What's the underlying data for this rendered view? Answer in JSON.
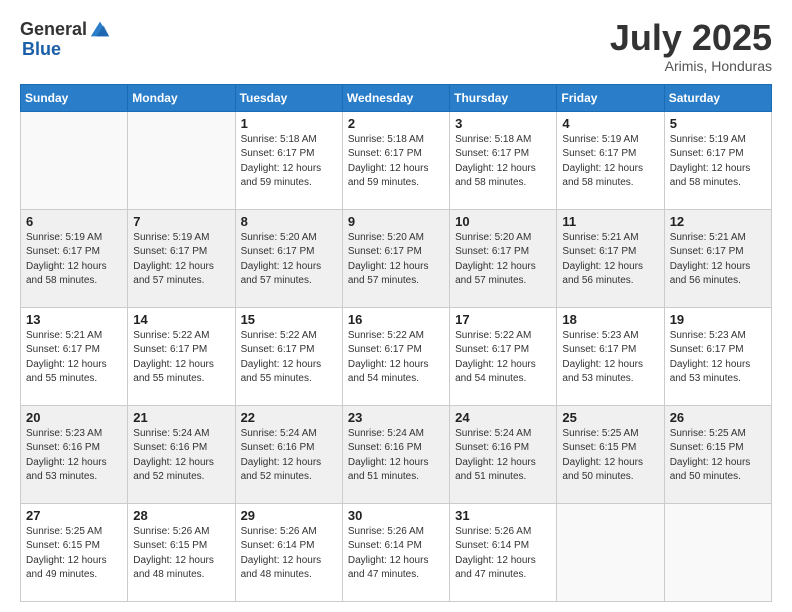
{
  "logo": {
    "text_general": "General",
    "text_blue": "Blue"
  },
  "header": {
    "month": "July 2025",
    "location": "Arimis, Honduras"
  },
  "days_of_week": [
    "Sunday",
    "Monday",
    "Tuesday",
    "Wednesday",
    "Thursday",
    "Friday",
    "Saturday"
  ],
  "weeks": [
    [
      {
        "day": null
      },
      {
        "day": null
      },
      {
        "day": "1",
        "sunrise": "Sunrise: 5:18 AM",
        "sunset": "Sunset: 6:17 PM",
        "daylight": "Daylight: 12 hours and 59 minutes."
      },
      {
        "day": "2",
        "sunrise": "Sunrise: 5:18 AM",
        "sunset": "Sunset: 6:17 PM",
        "daylight": "Daylight: 12 hours and 59 minutes."
      },
      {
        "day": "3",
        "sunrise": "Sunrise: 5:18 AM",
        "sunset": "Sunset: 6:17 PM",
        "daylight": "Daylight: 12 hours and 58 minutes."
      },
      {
        "day": "4",
        "sunrise": "Sunrise: 5:19 AM",
        "sunset": "Sunset: 6:17 PM",
        "daylight": "Daylight: 12 hours and 58 minutes."
      },
      {
        "day": "5",
        "sunrise": "Sunrise: 5:19 AM",
        "sunset": "Sunset: 6:17 PM",
        "daylight": "Daylight: 12 hours and 58 minutes."
      }
    ],
    [
      {
        "day": "6",
        "sunrise": "Sunrise: 5:19 AM",
        "sunset": "Sunset: 6:17 PM",
        "daylight": "Daylight: 12 hours and 58 minutes."
      },
      {
        "day": "7",
        "sunrise": "Sunrise: 5:19 AM",
        "sunset": "Sunset: 6:17 PM",
        "daylight": "Daylight: 12 hours and 57 minutes."
      },
      {
        "day": "8",
        "sunrise": "Sunrise: 5:20 AM",
        "sunset": "Sunset: 6:17 PM",
        "daylight": "Daylight: 12 hours and 57 minutes."
      },
      {
        "day": "9",
        "sunrise": "Sunrise: 5:20 AM",
        "sunset": "Sunset: 6:17 PM",
        "daylight": "Daylight: 12 hours and 57 minutes."
      },
      {
        "day": "10",
        "sunrise": "Sunrise: 5:20 AM",
        "sunset": "Sunset: 6:17 PM",
        "daylight": "Daylight: 12 hours and 57 minutes."
      },
      {
        "day": "11",
        "sunrise": "Sunrise: 5:21 AM",
        "sunset": "Sunset: 6:17 PM",
        "daylight": "Daylight: 12 hours and 56 minutes."
      },
      {
        "day": "12",
        "sunrise": "Sunrise: 5:21 AM",
        "sunset": "Sunset: 6:17 PM",
        "daylight": "Daylight: 12 hours and 56 minutes."
      }
    ],
    [
      {
        "day": "13",
        "sunrise": "Sunrise: 5:21 AM",
        "sunset": "Sunset: 6:17 PM",
        "daylight": "Daylight: 12 hours and 55 minutes."
      },
      {
        "day": "14",
        "sunrise": "Sunrise: 5:22 AM",
        "sunset": "Sunset: 6:17 PM",
        "daylight": "Daylight: 12 hours and 55 minutes."
      },
      {
        "day": "15",
        "sunrise": "Sunrise: 5:22 AM",
        "sunset": "Sunset: 6:17 PM",
        "daylight": "Daylight: 12 hours and 55 minutes."
      },
      {
        "day": "16",
        "sunrise": "Sunrise: 5:22 AM",
        "sunset": "Sunset: 6:17 PM",
        "daylight": "Daylight: 12 hours and 54 minutes."
      },
      {
        "day": "17",
        "sunrise": "Sunrise: 5:22 AM",
        "sunset": "Sunset: 6:17 PM",
        "daylight": "Daylight: 12 hours and 54 minutes."
      },
      {
        "day": "18",
        "sunrise": "Sunrise: 5:23 AM",
        "sunset": "Sunset: 6:17 PM",
        "daylight": "Daylight: 12 hours and 53 minutes."
      },
      {
        "day": "19",
        "sunrise": "Sunrise: 5:23 AM",
        "sunset": "Sunset: 6:17 PM",
        "daylight": "Daylight: 12 hours and 53 minutes."
      }
    ],
    [
      {
        "day": "20",
        "sunrise": "Sunrise: 5:23 AM",
        "sunset": "Sunset: 6:16 PM",
        "daylight": "Daylight: 12 hours and 53 minutes."
      },
      {
        "day": "21",
        "sunrise": "Sunrise: 5:24 AM",
        "sunset": "Sunset: 6:16 PM",
        "daylight": "Daylight: 12 hours and 52 minutes."
      },
      {
        "day": "22",
        "sunrise": "Sunrise: 5:24 AM",
        "sunset": "Sunset: 6:16 PM",
        "daylight": "Daylight: 12 hours and 52 minutes."
      },
      {
        "day": "23",
        "sunrise": "Sunrise: 5:24 AM",
        "sunset": "Sunset: 6:16 PM",
        "daylight": "Daylight: 12 hours and 51 minutes."
      },
      {
        "day": "24",
        "sunrise": "Sunrise: 5:24 AM",
        "sunset": "Sunset: 6:16 PM",
        "daylight": "Daylight: 12 hours and 51 minutes."
      },
      {
        "day": "25",
        "sunrise": "Sunrise: 5:25 AM",
        "sunset": "Sunset: 6:15 PM",
        "daylight": "Daylight: 12 hours and 50 minutes."
      },
      {
        "day": "26",
        "sunrise": "Sunrise: 5:25 AM",
        "sunset": "Sunset: 6:15 PM",
        "daylight": "Daylight: 12 hours and 50 minutes."
      }
    ],
    [
      {
        "day": "27",
        "sunrise": "Sunrise: 5:25 AM",
        "sunset": "Sunset: 6:15 PM",
        "daylight": "Daylight: 12 hours and 49 minutes."
      },
      {
        "day": "28",
        "sunrise": "Sunrise: 5:26 AM",
        "sunset": "Sunset: 6:15 PM",
        "daylight": "Daylight: 12 hours and 48 minutes."
      },
      {
        "day": "29",
        "sunrise": "Sunrise: 5:26 AM",
        "sunset": "Sunset: 6:14 PM",
        "daylight": "Daylight: 12 hours and 48 minutes."
      },
      {
        "day": "30",
        "sunrise": "Sunrise: 5:26 AM",
        "sunset": "Sunset: 6:14 PM",
        "daylight": "Daylight: 12 hours and 47 minutes."
      },
      {
        "day": "31",
        "sunrise": "Sunrise: 5:26 AM",
        "sunset": "Sunset: 6:14 PM",
        "daylight": "Daylight: 12 hours and 47 minutes."
      },
      {
        "day": null
      },
      {
        "day": null
      }
    ]
  ]
}
